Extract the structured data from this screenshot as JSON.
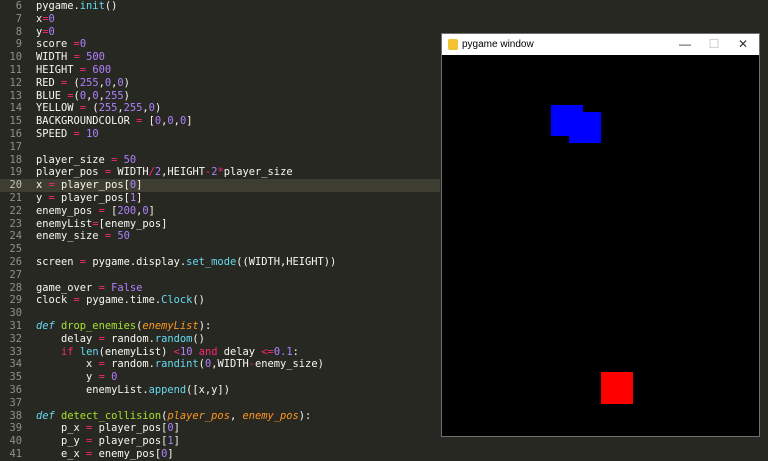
{
  "editor": {
    "lines": [
      {
        "n": "6",
        "tokens": [
          {
            "t": "pygame.",
            "c": "#f8f8f2"
          },
          {
            "t": "init",
            "c": "#66d9ef"
          },
          {
            "t": "()",
            "c": "#f8f8f2"
          }
        ]
      },
      {
        "n": "7",
        "tokens": [
          {
            "t": "x",
            "c": "#f8f8f2"
          },
          {
            "t": "=",
            "c": "#f92672"
          },
          {
            "t": "0",
            "c": "#ae81ff"
          }
        ]
      },
      {
        "n": "8",
        "tokens": [
          {
            "t": "y",
            "c": "#f8f8f2"
          },
          {
            "t": "=",
            "c": "#f92672"
          },
          {
            "t": "0",
            "c": "#ae81ff"
          }
        ]
      },
      {
        "n": "9",
        "tokens": [
          {
            "t": "score ",
            "c": "#f8f8f2"
          },
          {
            "t": "=",
            "c": "#f92672"
          },
          {
            "t": "0",
            "c": "#ae81ff"
          }
        ]
      },
      {
        "n": "10",
        "tokens": [
          {
            "t": "WIDTH ",
            "c": "#f8f8f2"
          },
          {
            "t": "=",
            "c": "#f92672"
          },
          {
            "t": " 500",
            "c": "#ae81ff"
          }
        ]
      },
      {
        "n": "11",
        "tokens": [
          {
            "t": "HEIGHT ",
            "c": "#f8f8f2"
          },
          {
            "t": "=",
            "c": "#f92672"
          },
          {
            "t": " 600",
            "c": "#ae81ff"
          }
        ]
      },
      {
        "n": "12",
        "tokens": [
          {
            "t": "RED ",
            "c": "#f8f8f2"
          },
          {
            "t": "=",
            "c": "#f92672"
          },
          {
            "t": " (",
            "c": "#f8f8f2"
          },
          {
            "t": "255",
            "c": "#ae81ff"
          },
          {
            "t": ",",
            "c": "#f8f8f2"
          },
          {
            "t": "0",
            "c": "#ae81ff"
          },
          {
            "t": ",",
            "c": "#f8f8f2"
          },
          {
            "t": "0",
            "c": "#ae81ff"
          },
          {
            "t": ")",
            "c": "#f8f8f2"
          }
        ]
      },
      {
        "n": "13",
        "tokens": [
          {
            "t": "BLUE ",
            "c": "#f8f8f2"
          },
          {
            "t": "=",
            "c": "#f92672"
          },
          {
            "t": "(",
            "c": "#f8f8f2"
          },
          {
            "t": "0",
            "c": "#ae81ff"
          },
          {
            "t": ",",
            "c": "#f8f8f2"
          },
          {
            "t": "0",
            "c": "#ae81ff"
          },
          {
            "t": ",",
            "c": "#f8f8f2"
          },
          {
            "t": "255",
            "c": "#ae81ff"
          },
          {
            "t": ")",
            "c": "#f8f8f2"
          }
        ]
      },
      {
        "n": "14",
        "tokens": [
          {
            "t": "YELLOW ",
            "c": "#f8f8f2"
          },
          {
            "t": "=",
            "c": "#f92672"
          },
          {
            "t": " (",
            "c": "#f8f8f2"
          },
          {
            "t": "255",
            "c": "#ae81ff"
          },
          {
            "t": ",",
            "c": "#f8f8f2"
          },
          {
            "t": "255",
            "c": "#ae81ff"
          },
          {
            "t": ",",
            "c": "#f8f8f2"
          },
          {
            "t": "0",
            "c": "#ae81ff"
          },
          {
            "t": ")",
            "c": "#f8f8f2"
          }
        ]
      },
      {
        "n": "15",
        "tokens": [
          {
            "t": "BACKGROUNDCOLOR ",
            "c": "#f8f8f2"
          },
          {
            "t": "=",
            "c": "#f92672"
          },
          {
            "t": " [",
            "c": "#f8f8f2"
          },
          {
            "t": "0",
            "c": "#ae81ff"
          },
          {
            "t": ",",
            "c": "#f8f8f2"
          },
          {
            "t": "0",
            "c": "#ae81ff"
          },
          {
            "t": ",",
            "c": "#f8f8f2"
          },
          {
            "t": "0",
            "c": "#ae81ff"
          },
          {
            "t": "]",
            "c": "#f8f8f2"
          }
        ]
      },
      {
        "n": "16",
        "tokens": [
          {
            "t": "SPEED ",
            "c": "#f8f8f2"
          },
          {
            "t": "=",
            "c": "#f92672"
          },
          {
            "t": " 10",
            "c": "#ae81ff"
          }
        ]
      },
      {
        "n": "17",
        "tokens": []
      },
      {
        "n": "18",
        "tokens": [
          {
            "t": "player_size ",
            "c": "#f8f8f2"
          },
          {
            "t": "=",
            "c": "#f92672"
          },
          {
            "t": " 50",
            "c": "#ae81ff"
          }
        ]
      },
      {
        "n": "19",
        "tokens": [
          {
            "t": "player_pos ",
            "c": "#f8f8f2"
          },
          {
            "t": "=",
            "c": "#f92672"
          },
          {
            "t": " WIDTH",
            "c": "#f8f8f2"
          },
          {
            "t": "/",
            "c": "#f92672"
          },
          {
            "t": "2",
            "c": "#ae81ff"
          },
          {
            "t": ",HEIGHT",
            "c": "#f8f8f2"
          },
          {
            "t": "-",
            "c": "#f92672"
          },
          {
            "t": "2",
            "c": "#ae81ff"
          },
          {
            "t": "*",
            "c": "#f92672"
          },
          {
            "t": "player_size",
            "c": "#f8f8f2"
          }
        ]
      },
      {
        "n": "20",
        "active": true,
        "tokens": [
          {
            "t": "x ",
            "c": "#f8f8f2"
          },
          {
            "t": "=",
            "c": "#f92672"
          },
          {
            "t": " player_pos[",
            "c": "#f8f8f2"
          },
          {
            "t": "0",
            "c": "#ae81ff"
          },
          {
            "t": "]",
            "c": "#f8f8f2"
          }
        ]
      },
      {
        "n": "21",
        "tokens": [
          {
            "t": "y ",
            "c": "#f8f8f2"
          },
          {
            "t": "=",
            "c": "#f92672"
          },
          {
            "t": " player_pos[",
            "c": "#f8f8f2"
          },
          {
            "t": "1",
            "c": "#ae81ff"
          },
          {
            "t": "]",
            "c": "#f8f8f2"
          }
        ]
      },
      {
        "n": "22",
        "tokens": [
          {
            "t": "enemy_pos ",
            "c": "#f8f8f2"
          },
          {
            "t": "=",
            "c": "#f92672"
          },
          {
            "t": " [",
            "c": "#f8f8f2"
          },
          {
            "t": "200",
            "c": "#ae81ff"
          },
          {
            "t": ",",
            "c": "#f8f8f2"
          },
          {
            "t": "0",
            "c": "#ae81ff"
          },
          {
            "t": "]",
            "c": "#f8f8f2"
          }
        ]
      },
      {
        "n": "23",
        "tokens": [
          {
            "t": "enemyList",
            "c": "#f8f8f2"
          },
          {
            "t": "=",
            "c": "#f92672"
          },
          {
            "t": "[enemy_pos]",
            "c": "#f8f8f2"
          }
        ]
      },
      {
        "n": "24",
        "tokens": [
          {
            "t": "enemy_size ",
            "c": "#f8f8f2"
          },
          {
            "t": "=",
            "c": "#f92672"
          },
          {
            "t": " 50",
            "c": "#ae81ff"
          }
        ]
      },
      {
        "n": "25",
        "tokens": []
      },
      {
        "n": "26",
        "tokens": [
          {
            "t": "screen ",
            "c": "#f8f8f2"
          },
          {
            "t": "=",
            "c": "#f92672"
          },
          {
            "t": " pygame.display.",
            "c": "#f8f8f2"
          },
          {
            "t": "set_mode",
            "c": "#66d9ef"
          },
          {
            "t": "((WIDTH,HEIGHT))",
            "c": "#f8f8f2"
          }
        ]
      },
      {
        "n": "27",
        "tokens": []
      },
      {
        "n": "28",
        "tokens": [
          {
            "t": "game_over ",
            "c": "#f8f8f2"
          },
          {
            "t": "=",
            "c": "#f92672"
          },
          {
            "t": " False",
            "c": "#ae81ff"
          }
        ]
      },
      {
        "n": "29",
        "tokens": [
          {
            "t": "clock ",
            "c": "#f8f8f2"
          },
          {
            "t": "=",
            "c": "#f92672"
          },
          {
            "t": " pygame.time.",
            "c": "#f8f8f2"
          },
          {
            "t": "Clock",
            "c": "#66d9ef"
          },
          {
            "t": "()",
            "c": "#f8f8f2"
          }
        ]
      },
      {
        "n": "30",
        "tokens": []
      },
      {
        "n": "31",
        "tokens": [
          {
            "t": "def ",
            "c": "#66d9ef",
            "i": true
          },
          {
            "t": "drop_enemies",
            "c": "#a6e22e"
          },
          {
            "t": "(",
            "c": "#f8f8f2"
          },
          {
            "t": "enemyList",
            "c": "#fd971f",
            "i": true
          },
          {
            "t": "):",
            "c": "#f8f8f2"
          }
        ]
      },
      {
        "n": "32",
        "tokens": [
          {
            "t": "    delay ",
            "c": "#f8f8f2"
          },
          {
            "t": "=",
            "c": "#f92672"
          },
          {
            "t": " random.",
            "c": "#f8f8f2"
          },
          {
            "t": "random",
            "c": "#66d9ef"
          },
          {
            "t": "()",
            "c": "#f8f8f2"
          }
        ]
      },
      {
        "n": "33",
        "tokens": [
          {
            "t": "    ",
            "c": "#f8f8f2"
          },
          {
            "t": "if ",
            "c": "#f92672"
          },
          {
            "t": "len",
            "c": "#66d9ef"
          },
          {
            "t": "(enemyList) ",
            "c": "#f8f8f2"
          },
          {
            "t": "<",
            "c": "#f92672"
          },
          {
            "t": "10 ",
            "c": "#ae81ff"
          },
          {
            "t": "and ",
            "c": "#f92672"
          },
          {
            "t": "delay ",
            "c": "#f8f8f2"
          },
          {
            "t": "<=",
            "c": "#f92672"
          },
          {
            "t": "0.1",
            "c": "#ae81ff"
          },
          {
            "t": ":",
            "c": "#f8f8f2"
          }
        ]
      },
      {
        "n": "34",
        "tokens": [
          {
            "t": "        x ",
            "c": "#f8f8f2"
          },
          {
            "t": "=",
            "c": "#f92672"
          },
          {
            "t": " random.",
            "c": "#f8f8f2"
          },
          {
            "t": "randint",
            "c": "#66d9ef"
          },
          {
            "t": "(",
            "c": "#f8f8f2"
          },
          {
            "t": "0",
            "c": "#ae81ff"
          },
          {
            "t": ",WIDTH",
            "c": "#f8f8f2"
          },
          {
            "t": "-",
            "c": "#f92672"
          },
          {
            "t": "enemy_size)",
            "c": "#f8f8f2"
          }
        ]
      },
      {
        "n": "35",
        "tokens": [
          {
            "t": "        y ",
            "c": "#f8f8f2"
          },
          {
            "t": "=",
            "c": "#f92672"
          },
          {
            "t": " 0",
            "c": "#ae81ff"
          }
        ]
      },
      {
        "n": "36",
        "tokens": [
          {
            "t": "        enemyList.",
            "c": "#f8f8f2"
          },
          {
            "t": "append",
            "c": "#66d9ef"
          },
          {
            "t": "([x,y])",
            "c": "#f8f8f2"
          }
        ]
      },
      {
        "n": "37",
        "tokens": []
      },
      {
        "n": "38",
        "tokens": [
          {
            "t": "def ",
            "c": "#66d9ef",
            "i": true
          },
          {
            "t": "detect_collision",
            "c": "#a6e22e"
          },
          {
            "t": "(",
            "c": "#f8f8f2"
          },
          {
            "t": "player_pos",
            "c": "#fd971f",
            "i": true
          },
          {
            "t": ", ",
            "c": "#f8f8f2"
          },
          {
            "t": "enemy_pos",
            "c": "#fd971f",
            "i": true
          },
          {
            "t": "):",
            "c": "#f8f8f2"
          }
        ]
      },
      {
        "n": "39",
        "tokens": [
          {
            "t": "    p_x ",
            "c": "#f8f8f2"
          },
          {
            "t": "=",
            "c": "#f92672"
          },
          {
            "t": " player_pos[",
            "c": "#f8f8f2"
          },
          {
            "t": "0",
            "c": "#ae81ff"
          },
          {
            "t": "]",
            "c": "#f8f8f2"
          }
        ]
      },
      {
        "n": "40",
        "tokens": [
          {
            "t": "    p_y ",
            "c": "#f8f8f2"
          },
          {
            "t": "=",
            "c": "#f92672"
          },
          {
            "t": " player_pos[",
            "c": "#f8f8f2"
          },
          {
            "t": "1",
            "c": "#ae81ff"
          },
          {
            "t": "]",
            "c": "#f8f8f2"
          }
        ]
      },
      {
        "n": "41",
        "tokens": [
          {
            "t": "    e_x ",
            "c": "#f8f8f2"
          },
          {
            "t": "=",
            "c": "#f92672"
          },
          {
            "t": " enemy_pos[",
            "c": "#f8f8f2"
          },
          {
            "t": "0",
            "c": "#ae81ff"
          },
          {
            "t": "]",
            "c": "#f8f8f2"
          }
        ]
      }
    ]
  },
  "pygame_window": {
    "title": "pygame window",
    "minimize_glyph": "—",
    "maximize_glyph": "☐",
    "close_glyph": "✕",
    "background": "#000000",
    "colors": {
      "enemy": "#0000ff",
      "player": "#ff0000"
    }
  }
}
